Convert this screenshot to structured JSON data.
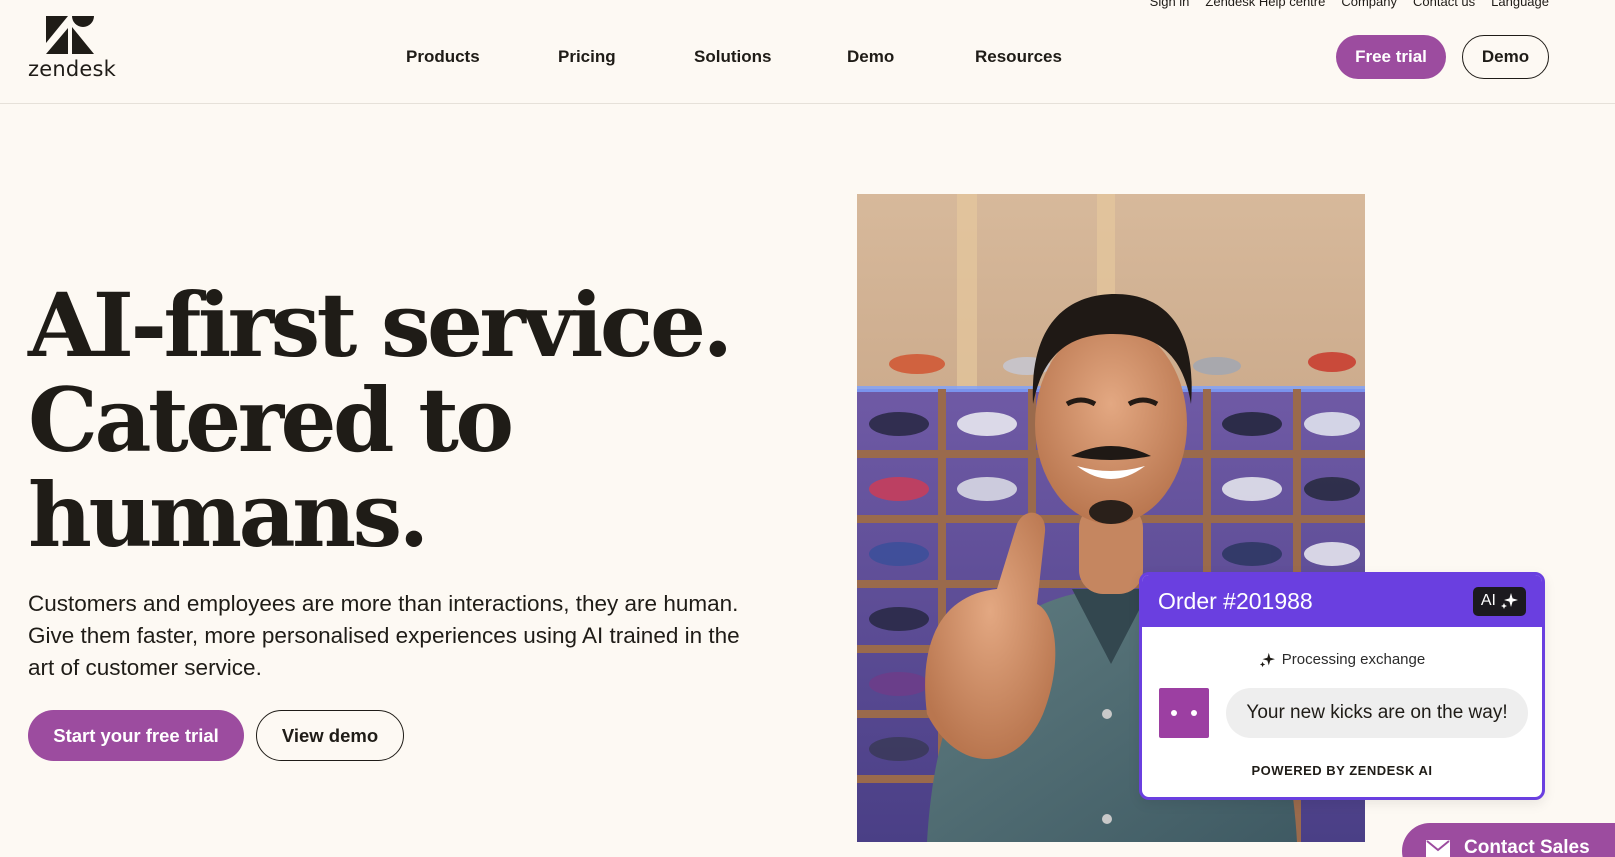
{
  "utility_nav": [
    {
      "label": "Sign in"
    },
    {
      "label": "Zendesk Help centre"
    },
    {
      "label": "Company"
    },
    {
      "label": "Contact us"
    },
    {
      "label": "Language"
    }
  ],
  "brand": {
    "name": "zendesk",
    "color": "#9c4c9f"
  },
  "main_nav": [
    {
      "label": "Products"
    },
    {
      "label": "Pricing"
    },
    {
      "label": "Solutions"
    },
    {
      "label": "Demo"
    },
    {
      "label": "Resources"
    }
  ],
  "header_actions": {
    "free_trial": "Free trial",
    "demo": "Demo"
  },
  "hero": {
    "title_lines": [
      "AI-first service.",
      "Catered to",
      "humans."
    ],
    "subtitle": "Customers and employees are more than interactions, they are human. Give them faster, more personalised experiences using AI trained in the art of customer service.",
    "primary_cta": "Start your free trial",
    "secondary_cta": "View demo"
  },
  "order_card": {
    "title": "Order #201988",
    "badge": "AI",
    "status": "Processing exchange",
    "message": "Your new kicks are on the way!",
    "footer": "POWERED BY ZENDESK AI",
    "accent": "#6a3fe0"
  },
  "contact_sales": {
    "label": "Contact Sales"
  },
  "icons": {
    "logo": "zendesk-logo",
    "sparkle": "sparkle-icon",
    "mail": "mail-icon"
  }
}
